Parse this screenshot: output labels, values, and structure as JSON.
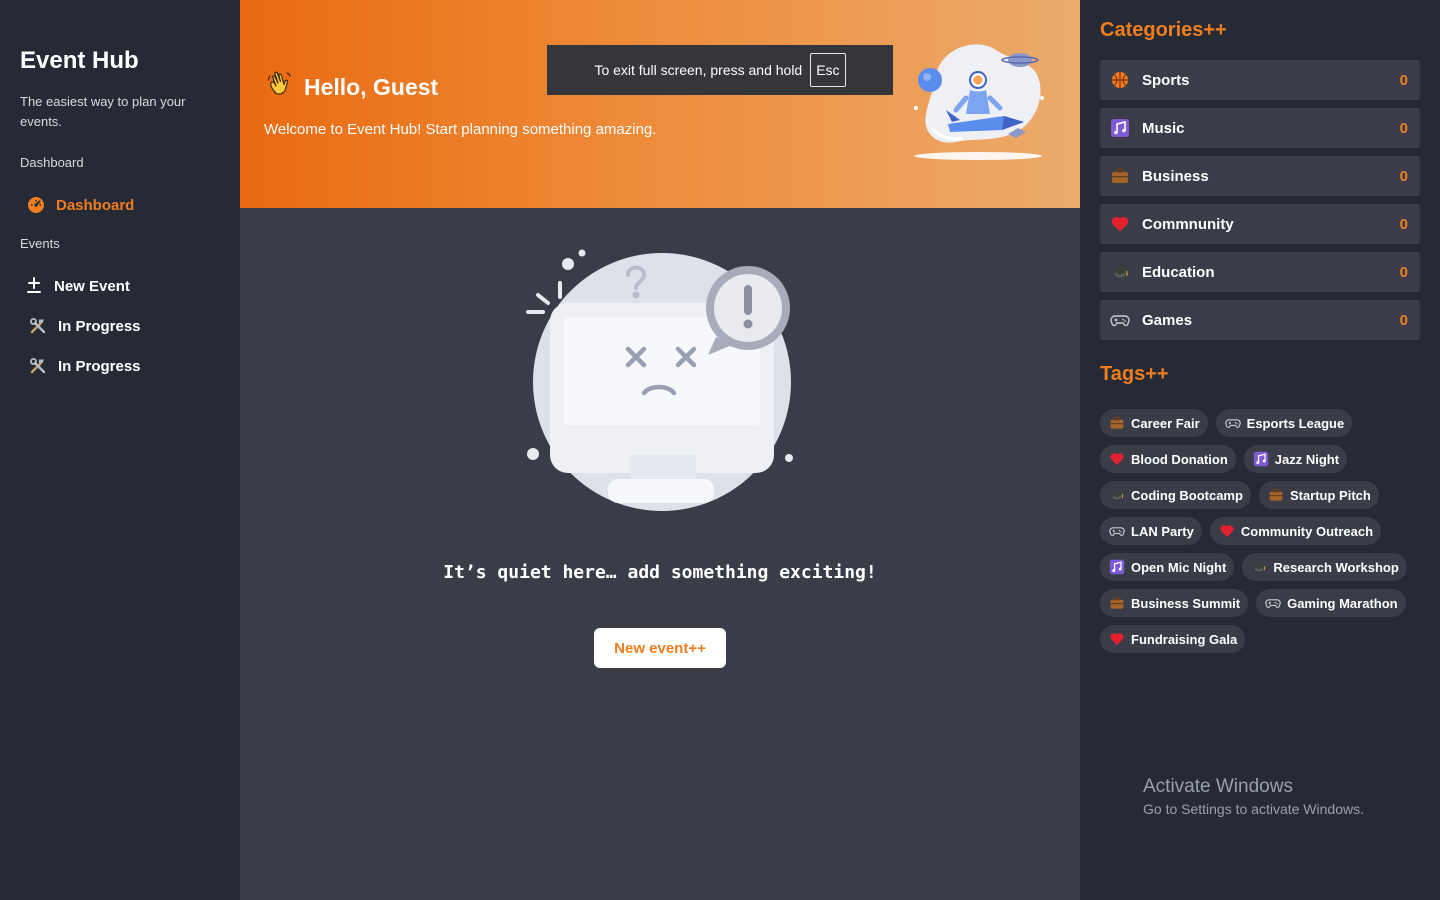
{
  "sidebar": {
    "brand": "Event Hub",
    "tagline": "The easiest way to plan your events.",
    "section_dashboard": "Dashboard",
    "dashboard_item": {
      "label": "Dashboard",
      "icon": "gauge-icon"
    },
    "section_events": "Events",
    "items": [
      {
        "label": "New Event",
        "icon": "plus-minus-icon"
      },
      {
        "label": "In Progress",
        "icon": "hammer-wrench-icon"
      },
      {
        "label": "In Progress",
        "icon": "hammer-wrench-icon"
      }
    ]
  },
  "hero": {
    "greeting": "Hello, Guest",
    "greeting_icon": "waving-hand-icon",
    "subtitle": "Welcome to Event Hub! Start planning something amazing."
  },
  "fullscreen_toast": {
    "text": "To exit full screen, press and hold",
    "key": "Esc"
  },
  "empty_state": {
    "message": "It’s quiet here… add something exciting!",
    "button_label": "New event++"
  },
  "categories": {
    "title": "Categories++",
    "items": [
      {
        "name": "Sports",
        "count": "0",
        "icon": "basketball-icon"
      },
      {
        "name": "Music",
        "count": "0",
        "icon": "music-notes-icon"
      },
      {
        "name": "Business",
        "count": "0",
        "icon": "briefcase-icon"
      },
      {
        "name": "Commnunity",
        "count": "0",
        "icon": "heart-icon"
      },
      {
        "name": "Education",
        "count": "0",
        "icon": "graduation-cap-icon"
      },
      {
        "name": "Games",
        "count": "0",
        "icon": "gamepad-icon"
      }
    ]
  },
  "tags": {
    "title": "Tags++",
    "items": [
      {
        "label": "Career Fair",
        "icon": "briefcase-icon"
      },
      {
        "label": "Esports League",
        "icon": "gamepad-icon"
      },
      {
        "label": "Blood Donation",
        "icon": "heart-icon"
      },
      {
        "label": "Jazz Night",
        "icon": "music-notes-icon"
      },
      {
        "label": "Coding Bootcamp",
        "icon": "graduation-cap-icon"
      },
      {
        "label": "Startup Pitch",
        "icon": "briefcase-icon"
      },
      {
        "label": "LAN Party",
        "icon": "gamepad-icon"
      },
      {
        "label": "Community Outreach",
        "icon": "heart-icon"
      },
      {
        "label": "Open Mic Night",
        "icon": "music-notes-icon"
      },
      {
        "label": "Research Workshop",
        "icon": "graduation-cap-icon"
      },
      {
        "label": "Business Summit",
        "icon": "briefcase-icon"
      },
      {
        "label": "Gaming Marathon",
        "icon": "gamepad-icon"
      },
      {
        "label": "Fundraising Gala",
        "icon": "heart-icon"
      }
    ]
  },
  "watermark": {
    "line1": "Activate Windows",
    "line2": "Go to Settings to activate Windows."
  },
  "colors": {
    "accent": "#f07d1e",
    "sidebar_bg": "#262a35",
    "main_bg": "#3a3d48",
    "card_bg": "#3a3d48"
  }
}
